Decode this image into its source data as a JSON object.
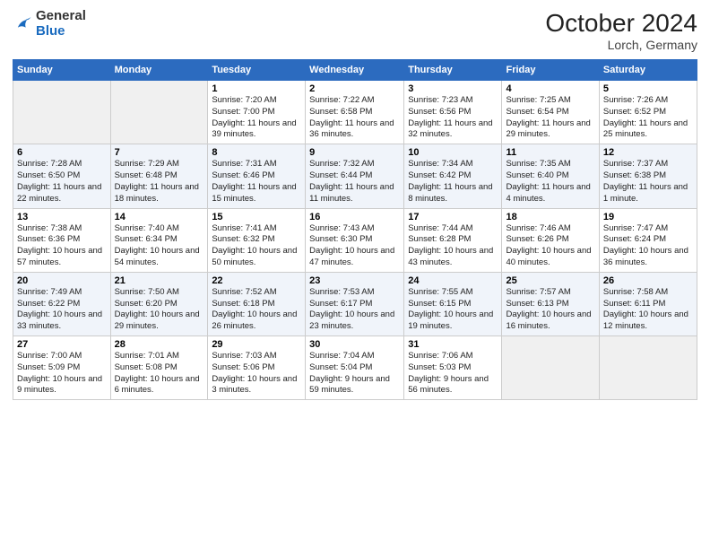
{
  "header": {
    "logo_general": "General",
    "logo_blue": "Blue",
    "month_title": "October 2024",
    "location": "Lorch, Germany"
  },
  "days_of_week": [
    "Sunday",
    "Monday",
    "Tuesday",
    "Wednesday",
    "Thursday",
    "Friday",
    "Saturday"
  ],
  "weeks": [
    [
      {
        "day": "",
        "sunrise": "",
        "sunset": "",
        "daylight": ""
      },
      {
        "day": "",
        "sunrise": "",
        "sunset": "",
        "daylight": ""
      },
      {
        "day": "1",
        "sunrise": "Sunrise: 7:20 AM",
        "sunset": "Sunset: 7:00 PM",
        "daylight": "Daylight: 11 hours and 39 minutes."
      },
      {
        "day": "2",
        "sunrise": "Sunrise: 7:22 AM",
        "sunset": "Sunset: 6:58 PM",
        "daylight": "Daylight: 11 hours and 36 minutes."
      },
      {
        "day": "3",
        "sunrise": "Sunrise: 7:23 AM",
        "sunset": "Sunset: 6:56 PM",
        "daylight": "Daylight: 11 hours and 32 minutes."
      },
      {
        "day": "4",
        "sunrise": "Sunrise: 7:25 AM",
        "sunset": "Sunset: 6:54 PM",
        "daylight": "Daylight: 11 hours and 29 minutes."
      },
      {
        "day": "5",
        "sunrise": "Sunrise: 7:26 AM",
        "sunset": "Sunset: 6:52 PM",
        "daylight": "Daylight: 11 hours and 25 minutes."
      }
    ],
    [
      {
        "day": "6",
        "sunrise": "Sunrise: 7:28 AM",
        "sunset": "Sunset: 6:50 PM",
        "daylight": "Daylight: 11 hours and 22 minutes."
      },
      {
        "day": "7",
        "sunrise": "Sunrise: 7:29 AM",
        "sunset": "Sunset: 6:48 PM",
        "daylight": "Daylight: 11 hours and 18 minutes."
      },
      {
        "day": "8",
        "sunrise": "Sunrise: 7:31 AM",
        "sunset": "Sunset: 6:46 PM",
        "daylight": "Daylight: 11 hours and 15 minutes."
      },
      {
        "day": "9",
        "sunrise": "Sunrise: 7:32 AM",
        "sunset": "Sunset: 6:44 PM",
        "daylight": "Daylight: 11 hours and 11 minutes."
      },
      {
        "day": "10",
        "sunrise": "Sunrise: 7:34 AM",
        "sunset": "Sunset: 6:42 PM",
        "daylight": "Daylight: 11 hours and 8 minutes."
      },
      {
        "day": "11",
        "sunrise": "Sunrise: 7:35 AM",
        "sunset": "Sunset: 6:40 PM",
        "daylight": "Daylight: 11 hours and 4 minutes."
      },
      {
        "day": "12",
        "sunrise": "Sunrise: 7:37 AM",
        "sunset": "Sunset: 6:38 PM",
        "daylight": "Daylight: 11 hours and 1 minute."
      }
    ],
    [
      {
        "day": "13",
        "sunrise": "Sunrise: 7:38 AM",
        "sunset": "Sunset: 6:36 PM",
        "daylight": "Daylight: 10 hours and 57 minutes."
      },
      {
        "day": "14",
        "sunrise": "Sunrise: 7:40 AM",
        "sunset": "Sunset: 6:34 PM",
        "daylight": "Daylight: 10 hours and 54 minutes."
      },
      {
        "day": "15",
        "sunrise": "Sunrise: 7:41 AM",
        "sunset": "Sunset: 6:32 PM",
        "daylight": "Daylight: 10 hours and 50 minutes."
      },
      {
        "day": "16",
        "sunrise": "Sunrise: 7:43 AM",
        "sunset": "Sunset: 6:30 PM",
        "daylight": "Daylight: 10 hours and 47 minutes."
      },
      {
        "day": "17",
        "sunrise": "Sunrise: 7:44 AM",
        "sunset": "Sunset: 6:28 PM",
        "daylight": "Daylight: 10 hours and 43 minutes."
      },
      {
        "day": "18",
        "sunrise": "Sunrise: 7:46 AM",
        "sunset": "Sunset: 6:26 PM",
        "daylight": "Daylight: 10 hours and 40 minutes."
      },
      {
        "day": "19",
        "sunrise": "Sunrise: 7:47 AM",
        "sunset": "Sunset: 6:24 PM",
        "daylight": "Daylight: 10 hours and 36 minutes."
      }
    ],
    [
      {
        "day": "20",
        "sunrise": "Sunrise: 7:49 AM",
        "sunset": "Sunset: 6:22 PM",
        "daylight": "Daylight: 10 hours and 33 minutes."
      },
      {
        "day": "21",
        "sunrise": "Sunrise: 7:50 AM",
        "sunset": "Sunset: 6:20 PM",
        "daylight": "Daylight: 10 hours and 29 minutes."
      },
      {
        "day": "22",
        "sunrise": "Sunrise: 7:52 AM",
        "sunset": "Sunset: 6:18 PM",
        "daylight": "Daylight: 10 hours and 26 minutes."
      },
      {
        "day": "23",
        "sunrise": "Sunrise: 7:53 AM",
        "sunset": "Sunset: 6:17 PM",
        "daylight": "Daylight: 10 hours and 23 minutes."
      },
      {
        "day": "24",
        "sunrise": "Sunrise: 7:55 AM",
        "sunset": "Sunset: 6:15 PM",
        "daylight": "Daylight: 10 hours and 19 minutes."
      },
      {
        "day": "25",
        "sunrise": "Sunrise: 7:57 AM",
        "sunset": "Sunset: 6:13 PM",
        "daylight": "Daylight: 10 hours and 16 minutes."
      },
      {
        "day": "26",
        "sunrise": "Sunrise: 7:58 AM",
        "sunset": "Sunset: 6:11 PM",
        "daylight": "Daylight: 10 hours and 12 minutes."
      }
    ],
    [
      {
        "day": "27",
        "sunrise": "Sunrise: 7:00 AM",
        "sunset": "Sunset: 5:09 PM",
        "daylight": "Daylight: 10 hours and 9 minutes."
      },
      {
        "day": "28",
        "sunrise": "Sunrise: 7:01 AM",
        "sunset": "Sunset: 5:08 PM",
        "daylight": "Daylight: 10 hours and 6 minutes."
      },
      {
        "day": "29",
        "sunrise": "Sunrise: 7:03 AM",
        "sunset": "Sunset: 5:06 PM",
        "daylight": "Daylight: 10 hours and 3 minutes."
      },
      {
        "day": "30",
        "sunrise": "Sunrise: 7:04 AM",
        "sunset": "Sunset: 5:04 PM",
        "daylight": "Daylight: 9 hours and 59 minutes."
      },
      {
        "day": "31",
        "sunrise": "Sunrise: 7:06 AM",
        "sunset": "Sunset: 5:03 PM",
        "daylight": "Daylight: 9 hours and 56 minutes."
      },
      {
        "day": "",
        "sunrise": "",
        "sunset": "",
        "daylight": ""
      },
      {
        "day": "",
        "sunrise": "",
        "sunset": "",
        "daylight": ""
      }
    ]
  ]
}
